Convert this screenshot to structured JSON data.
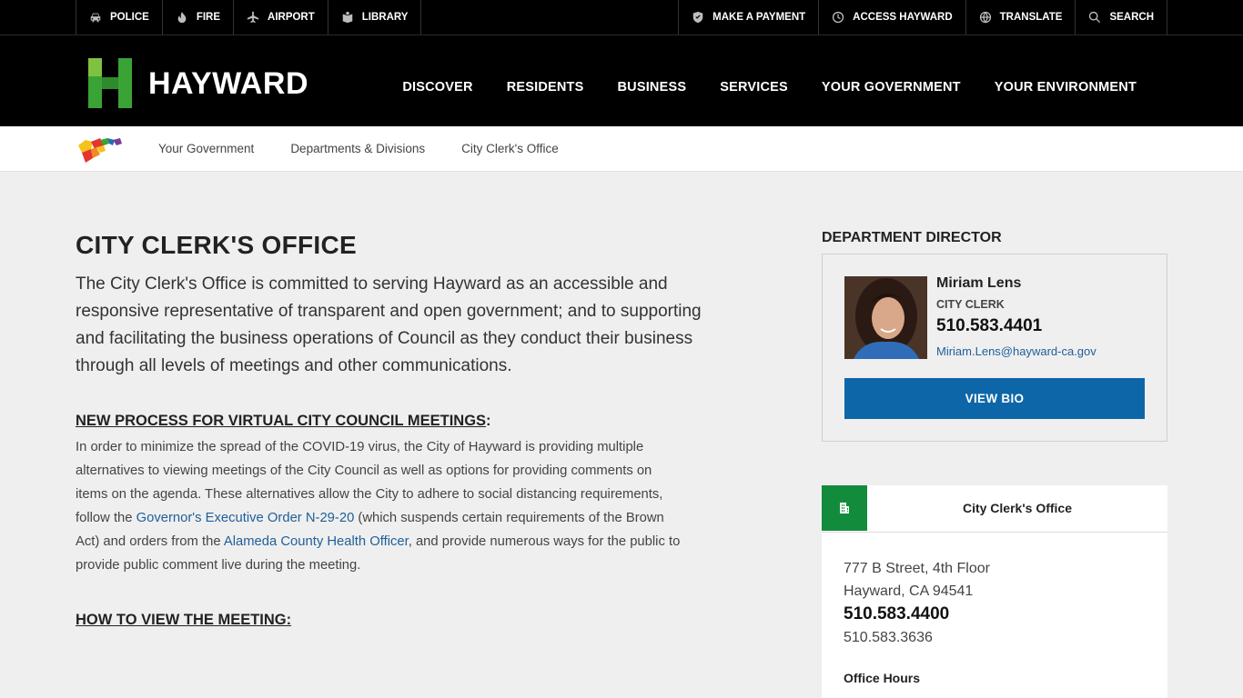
{
  "topbar": {
    "left": [
      {
        "label": "POLICE",
        "icon": "police-car-icon"
      },
      {
        "label": "FIRE",
        "icon": "flame-icon"
      },
      {
        "label": "AIRPORT",
        "icon": "airplane-icon"
      },
      {
        "label": "LIBRARY",
        "icon": "book-icon"
      }
    ],
    "right": [
      {
        "label": "MAKE A PAYMENT",
        "icon": "shield-check-icon"
      },
      {
        "label": "ACCESS HAYWARD",
        "icon": "clock-icon"
      },
      {
        "label": "TRANSLATE",
        "icon": "globe-icon"
      },
      {
        "label": "SEARCH",
        "icon": "search-icon"
      }
    ]
  },
  "header": {
    "logo_text": "HAYWARD",
    "nav": [
      "DISCOVER",
      "RESIDENTS",
      "BUSINESS",
      "SERVICES",
      "YOUR GOVERNMENT",
      "YOUR ENVIRONMENT"
    ]
  },
  "breadcrumb": [
    "Your Government",
    "Departments & Divisions",
    "City Clerk's Office"
  ],
  "main": {
    "title": "CITY CLERK'S OFFICE",
    "intro": "The City Clerk's Office is committed to serving Hayward as an accessible and responsive representative of transparent and open government; and to supporting and facilitating the business operations of Council as they conduct their business through all levels of meetings and other communications.",
    "section1_heading": "NEW PROCESS FOR VIRTUAL CITY COUNCIL MEETINGS",
    "section1_colon": ":",
    "section1_p1": "In order to minimize the spread of the COVID-19 virus, the City of Hayward is providing multiple alternatives to viewing meetings of the City Council as well as options for providing comments on items on the agenda. These alternatives allow the City to adhere to social distancing requirements, follow the ",
    "section1_link1": "Governor's Executive Order N-29-20",
    "section1_p2": " (which suspends certain requirements of the Brown Act) and orders from the ",
    "section1_link2": "Alameda County Health Officer",
    "section1_p3": ", and provide numerous ways for the public to provide public comment live during the meeting.",
    "section2_heading": "HOW TO VIEW THE MEETING:"
  },
  "sidebar": {
    "director_heading": "DEPARTMENT DIRECTOR",
    "director_name": "Miriam Lens",
    "director_role": "CITY CLERK",
    "director_phone": "510.583.4401",
    "director_email": "Miriam.Lens@hayward-ca.gov",
    "view_bio_label": "VIEW BIO",
    "office_name": "City Clerk's Office",
    "office_address_1": "777 B Street, 4th Floor",
    "office_address_2": "Hayward, CA 94541",
    "office_phone": "510.583.4400",
    "office_fax": "510.583.3636",
    "office_hours_label": "Office Hours"
  },
  "colors": {
    "accent_blue": "#0d66a8",
    "link_blue": "#1f5f99",
    "brand_green": "#138b3c",
    "header_bg": "#000000"
  }
}
